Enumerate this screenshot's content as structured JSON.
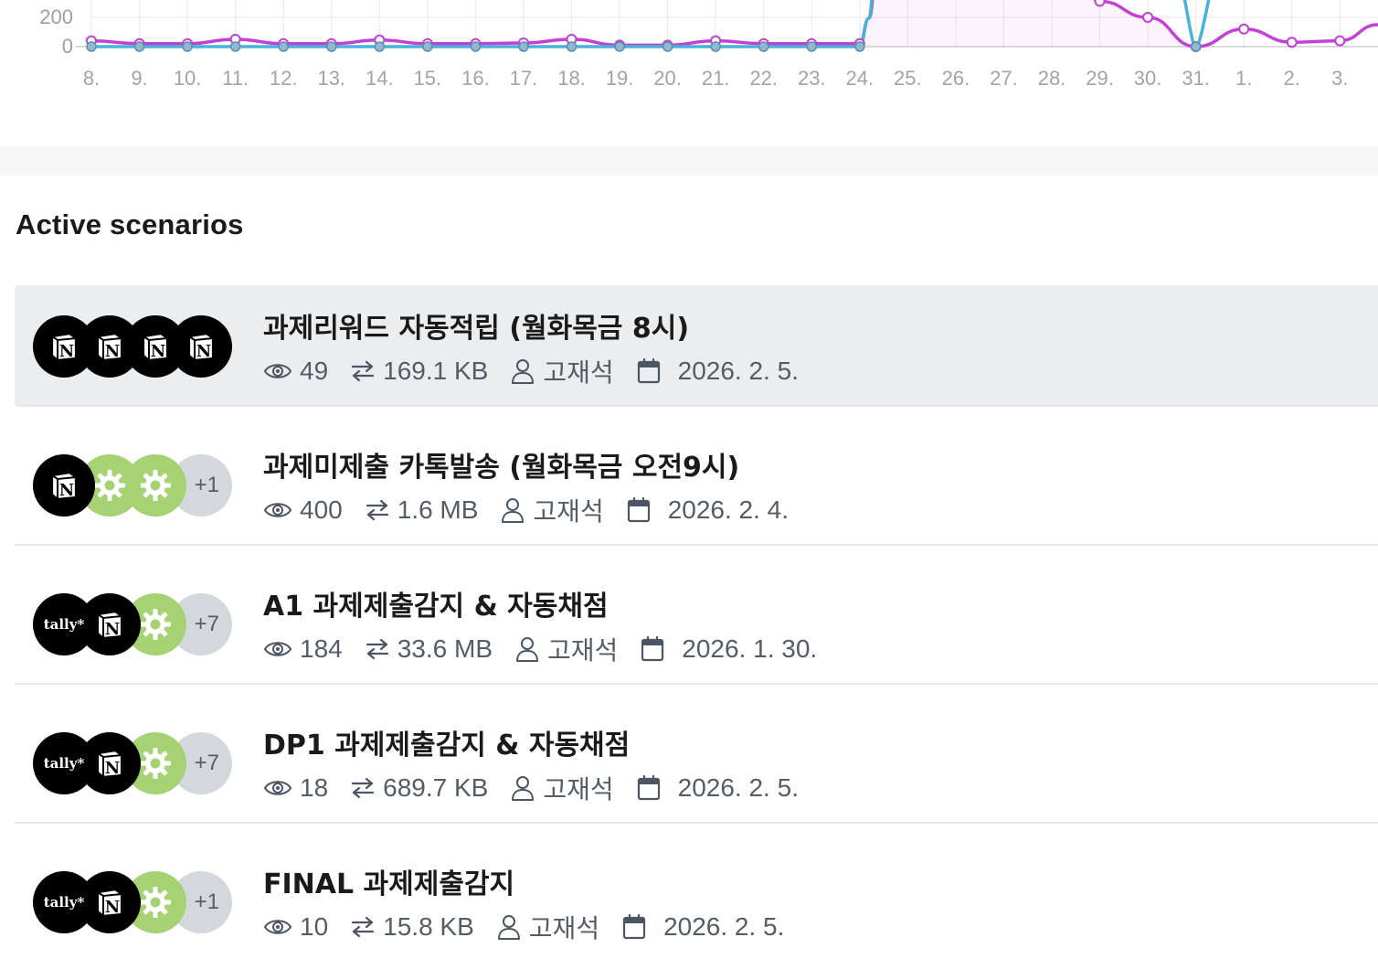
{
  "chart_data": {
    "type": "line",
    "x": [
      "8.",
      "9.",
      "10.",
      "11.",
      "12.",
      "13.",
      "14.",
      "15.",
      "16.",
      "17.",
      "18.",
      "19.",
      "20.",
      "21.",
      "22.",
      "23.",
      "24.",
      "25.",
      "26.",
      "27.",
      "28.",
      "29.",
      "30.",
      "31.",
      "1.",
      "2.",
      "3."
    ],
    "y_ticks": [
      "0",
      "200"
    ],
    "series": [
      {
        "color": "#c43fd8",
        "values": [
          40,
          20,
          20,
          50,
          20,
          20,
          45,
          20,
          20,
          25,
          50,
          10,
          10,
          40,
          20,
          20,
          20,
          null,
          null,
          null,
          null,
          310,
          200,
          0,
          120,
          30,
          40
        ]
      },
      {
        "color": "#4ab2da",
        "values": [
          0,
          0,
          0,
          0,
          0,
          0,
          0,
          0,
          0,
          0,
          0,
          0,
          0,
          0,
          0,
          0,
          0,
          null,
          null,
          null,
          null,
          null,
          null,
          0,
          null,
          null,
          null
        ]
      }
    ],
    "grid": true
  },
  "section": {
    "title": "Active scenarios"
  },
  "scenarios": [
    {
      "title": "과제리워드 자동적립 (월화목금 8시)",
      "ops": "49",
      "size": "169.1 KB",
      "owner": "고재석",
      "date": "2026. 2. 5.",
      "icons": [
        "notion-icon",
        "notion-icon",
        "notion-icon",
        "notion-icon"
      ]
    },
    {
      "title": "과제미제출 카톡발송 (월화목금 오전9시)",
      "ops": "400",
      "size": "1.6 MB",
      "owner": "고재석",
      "date": "2026. 2. 4.",
      "icons": [
        "notion-icon",
        "gear-icon",
        "gear-icon"
      ],
      "more": "+1"
    },
    {
      "title": "A1 과제제출감지 & 자동채점",
      "ops": "184",
      "size": "33.6 MB",
      "owner": "고재석",
      "date": "2026. 1. 30.",
      "icons": [
        "tally-icon",
        "notion-icon",
        "gear-icon"
      ],
      "more": "+7"
    },
    {
      "title": "DP1 과제제출감지 & 자동채점",
      "ops": "18",
      "size": "689.7 KB",
      "owner": "고재석",
      "date": "2026. 2. 5.",
      "icons": [
        "tally-icon",
        "notion-icon",
        "gear-icon"
      ],
      "more": "+7"
    },
    {
      "title": "FINAL 과제제출감지",
      "ops": "10",
      "size": "15.8 KB",
      "owner": "고재석",
      "date": "2026. 2. 5.",
      "icons": [
        "tally-icon",
        "notion-icon",
        "gear-icon"
      ],
      "more": "+1"
    }
  ],
  "tally_label": "tally*"
}
